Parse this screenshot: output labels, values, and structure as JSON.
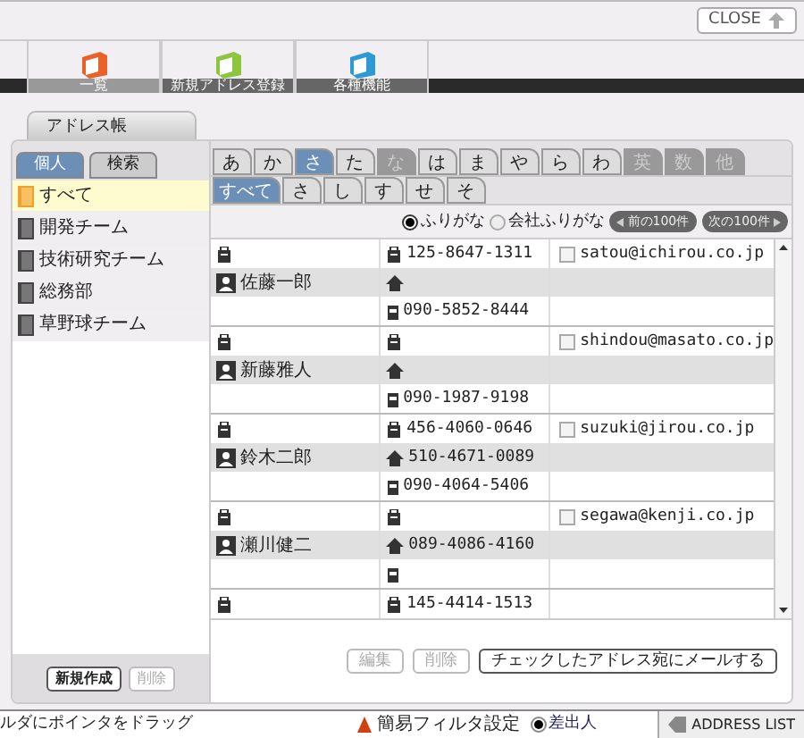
{
  "close_button": "CLOSE",
  "toolbar": [
    {
      "label": "一覧",
      "selected": true,
      "color": "#e8622a"
    },
    {
      "label": "新規アドレス登録",
      "selected": false,
      "color": "#8cc63f"
    },
    {
      "label": "各種機能",
      "selected": false,
      "color": "#2d9ad6"
    }
  ],
  "panel_tab": "アドレス帳",
  "left_tabs": [
    {
      "label": "個人",
      "selected": true
    },
    {
      "label": "検索",
      "selected": false
    }
  ],
  "groups": [
    {
      "label": "すべて",
      "selected": true
    },
    {
      "label": "開発チーム",
      "selected": false
    },
    {
      "label": "技術研究チーム",
      "selected": false
    },
    {
      "label": "総務部",
      "selected": false
    },
    {
      "label": "草野球チーム",
      "selected": false
    }
  ],
  "left_buttons": [
    {
      "label": "新規作成",
      "disabled": false
    },
    {
      "label": "削除",
      "disabled": true
    }
  ],
  "kana_tabs": [
    {
      "label": "あ",
      "selected": false,
      "disabled": false
    },
    {
      "label": "か",
      "selected": false,
      "disabled": false
    },
    {
      "label": "さ",
      "selected": true,
      "disabled": false
    },
    {
      "label": "た",
      "selected": false,
      "disabled": false
    },
    {
      "label": "な",
      "selected": false,
      "disabled": true
    },
    {
      "label": "は",
      "selected": false,
      "disabled": false
    },
    {
      "label": "ま",
      "selected": false,
      "disabled": false
    },
    {
      "label": "や",
      "selected": false,
      "disabled": false
    },
    {
      "label": "ら",
      "selected": false,
      "disabled": false
    },
    {
      "label": "わ",
      "selected": false,
      "disabled": false
    },
    {
      "label": "英",
      "selected": false,
      "disabled": true
    },
    {
      "label": "数",
      "selected": false,
      "disabled": true
    },
    {
      "label": "他",
      "selected": false,
      "disabled": true
    }
  ],
  "sub_tabs": [
    {
      "label": "すべて",
      "selected": true
    },
    {
      "label": "さ",
      "selected": false
    },
    {
      "label": "し",
      "selected": false
    },
    {
      "label": "す",
      "selected": false
    },
    {
      "label": "せ",
      "selected": false
    },
    {
      "label": "そ",
      "selected": false
    }
  ],
  "sort_options": [
    {
      "label": "ふりがな",
      "selected": true
    },
    {
      "label": "会社ふりがな",
      "selected": false
    }
  ],
  "paging": [
    {
      "label": "前の100件",
      "kind": "prev"
    },
    {
      "label": "次の100件",
      "kind": "next"
    }
  ],
  "contacts": [
    {
      "name": "佐藤一郎",
      "work": "125-8647-1311",
      "mobile": "090-5852-8444",
      "email": "satou@ichirou.co.jp",
      "checked": false
    },
    {
      "name": "新藤雅人",
      "mobile": "090-1987-9198",
      "email": "shindou@masato.co.jp",
      "checked": false
    },
    {
      "name": "鈴木二郎",
      "work": "456-4060-0646",
      "home": "510-4671-0089",
      "mobile": "090-4064-5406",
      "email": "suzuki@jirou.co.jp",
      "checked": false
    },
    {
      "name": "瀬川健二",
      "home": "089-4086-4160",
      "email": "segawa@kenji.co.jp",
      "checked": false
    },
    {
      "work": "145-4414-1513"
    }
  ],
  "right_buttons": [
    {
      "label": "編集",
      "disabled": true
    },
    {
      "label": "削除",
      "disabled": true
    },
    {
      "label": "チェックしたアドレス宛にメールする",
      "disabled": false
    }
  ],
  "status_bar": {
    "hint": "ルダにポインタをドラッグ",
    "filter": "簡易フィルタ設定",
    "option": {
      "label": "差出人",
      "selected": true
    },
    "tab": "ADDRESS LIST"
  }
}
